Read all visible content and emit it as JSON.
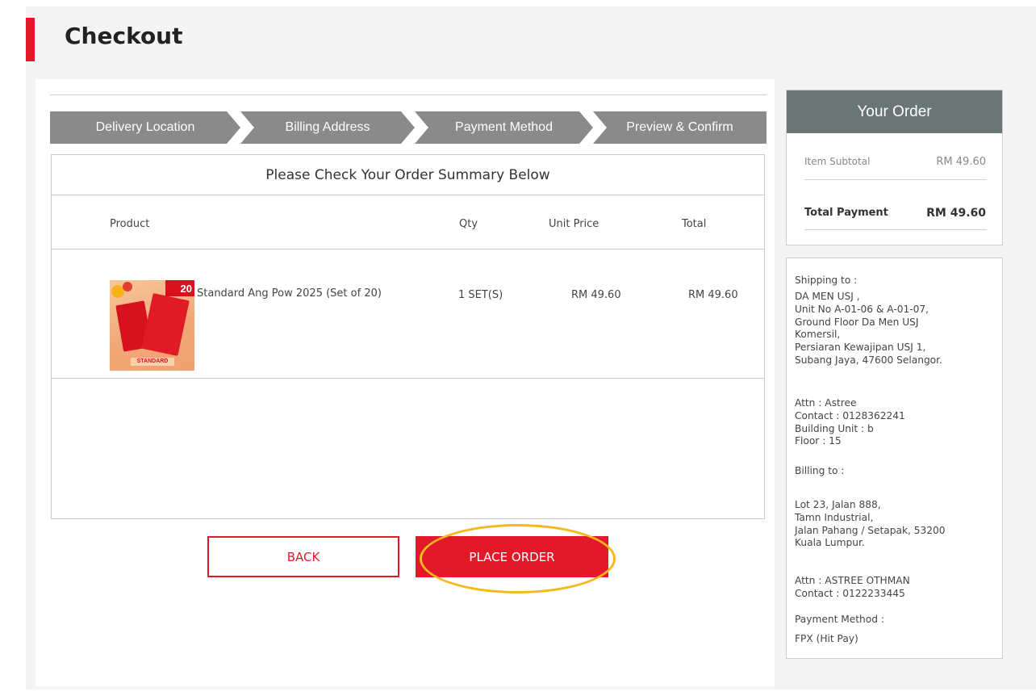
{
  "page": {
    "title": "Checkout"
  },
  "steps": [
    {
      "label": "Delivery Location"
    },
    {
      "label": "Billing Address"
    },
    {
      "label": "Payment Method"
    },
    {
      "label": "Preview & Confirm"
    }
  ],
  "summary": {
    "title": "Please Check Your Order Summary Below",
    "columns": {
      "product": "Product",
      "qty": "Qty",
      "unit_price": "Unit Price",
      "total": "Total"
    },
    "items": [
      {
        "name": "Standard Ang Pow 2025 (Set of 20)",
        "qty": "1 SET(S)",
        "unit_price": "RM 49.60",
        "total": "RM 49.60",
        "image_badge": "20",
        "image_label": "STANDARD"
      }
    ]
  },
  "actions": {
    "back": "BACK",
    "place_order": "PLACE ORDER"
  },
  "order": {
    "title": "Your Order",
    "subtotal_label": "Item Subtotal",
    "subtotal_value": "RM 49.60",
    "total_label": "Total Payment",
    "total_value": "RM 49.60"
  },
  "shipping": {
    "heading": "Shipping to :",
    "lines": [
      "DA MEN USJ ,",
      "Unit No A-01-06 & A-01-07,",
      "Ground Floor Da Men USJ",
      "Komersil,",
      "Persiaran Kewajipan USJ 1,",
      "Subang Jaya, 47600 Selangor."
    ],
    "attn": "Attn : Astree",
    "contact": "Contact : 0128362241",
    "building": "Building Unit : b",
    "floor": "Floor : 15"
  },
  "billing": {
    "heading": "Billing to :",
    "lines": [
      "Lot 23, Jalan 888,",
      "Tamn Industrial,",
      "Jalan Pahang / Setapak, 53200",
      "Kuala Lumpur."
    ],
    "attn": "Attn : ASTREE OTHMAN",
    "contact": "Contact : 0122233445"
  },
  "payment": {
    "heading": "Payment Method :",
    "value": "FPX (Hit Pay)"
  },
  "colors": {
    "accent": "#e3192b",
    "step_bg": "#8a8a8a",
    "order_header": "#6a7576",
    "highlight": "#f5b81c"
  }
}
